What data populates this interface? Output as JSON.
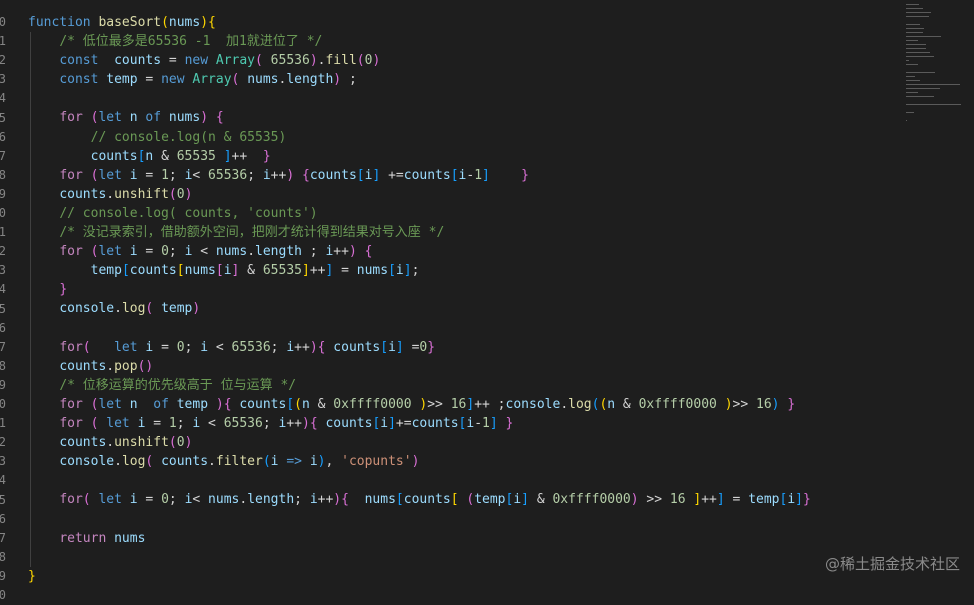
{
  "editor": {
    "gutter_numbers": [
      "0",
      "1",
      "2",
      "3",
      "4",
      "5",
      "6",
      "7",
      "8",
      "9",
      "0",
      "1",
      "2",
      "3",
      "4",
      "5",
      "6",
      "7",
      "8",
      "9",
      "0",
      "1",
      "2",
      "3",
      "4",
      "5",
      "6",
      "7",
      "8",
      "9",
      "0"
    ],
    "code_lines": [
      [
        [
          "kw",
          "function"
        ],
        [
          "op",
          " "
        ],
        [
          "fn",
          "baseSort"
        ],
        [
          "p1",
          "("
        ],
        [
          "var",
          "nums"
        ],
        [
          "p1",
          ")"
        ],
        [
          "p1",
          "{"
        ]
      ],
      [
        [
          "op",
          "    "
        ],
        [
          "cmt",
          "/* 低位最多是65536 -1  加1就进位了 */"
        ]
      ],
      [
        [
          "op",
          "    "
        ],
        [
          "kw",
          "const"
        ],
        [
          "op",
          "  "
        ],
        [
          "var",
          "counts"
        ],
        [
          "op",
          " = "
        ],
        [
          "kw",
          "new"
        ],
        [
          "op",
          " "
        ],
        [
          "cls",
          "Array"
        ],
        [
          "p2",
          "("
        ],
        [
          "op",
          " "
        ],
        [
          "num",
          "65536"
        ],
        [
          "p2",
          ")"
        ],
        [
          "op",
          "."
        ],
        [
          "fn",
          "fill"
        ],
        [
          "p2",
          "("
        ],
        [
          "num",
          "0"
        ],
        [
          "p2",
          ")"
        ]
      ],
      [
        [
          "op",
          "    "
        ],
        [
          "kw",
          "const"
        ],
        [
          "op",
          " "
        ],
        [
          "var",
          "temp"
        ],
        [
          "op",
          " = "
        ],
        [
          "kw",
          "new"
        ],
        [
          "op",
          " "
        ],
        [
          "cls",
          "Array"
        ],
        [
          "p2",
          "("
        ],
        [
          "op",
          " "
        ],
        [
          "var",
          "nums"
        ],
        [
          "op",
          "."
        ],
        [
          "var",
          "length"
        ],
        [
          "p2",
          ")"
        ],
        [
          "op",
          " ;"
        ]
      ],
      [
        [
          "op",
          ""
        ]
      ],
      [
        [
          "op",
          "    "
        ],
        [
          "ctl",
          "for"
        ],
        [
          "op",
          " "
        ],
        [
          "p2",
          "("
        ],
        [
          "kw",
          "let"
        ],
        [
          "op",
          " "
        ],
        [
          "var",
          "n"
        ],
        [
          "op",
          " "
        ],
        [
          "kw",
          "of"
        ],
        [
          "op",
          " "
        ],
        [
          "var",
          "nums"
        ],
        [
          "p2",
          ")"
        ],
        [
          "op",
          " "
        ],
        [
          "p2",
          "{"
        ]
      ],
      [
        [
          "op",
          "        "
        ],
        [
          "cmt",
          "// console.log(n & 65535)"
        ]
      ],
      [
        [
          "op",
          "        "
        ],
        [
          "var",
          "counts"
        ],
        [
          "p3",
          "["
        ],
        [
          "var",
          "n"
        ],
        [
          "op",
          " & "
        ],
        [
          "num",
          "65535"
        ],
        [
          "op",
          " "
        ],
        [
          "p3",
          "]"
        ],
        [
          "op",
          "++  "
        ],
        [
          "p2",
          "}"
        ]
      ],
      [
        [
          "op",
          "    "
        ],
        [
          "ctl",
          "for"
        ],
        [
          "op",
          " "
        ],
        [
          "p2",
          "("
        ],
        [
          "kw",
          "let"
        ],
        [
          "op",
          " "
        ],
        [
          "var",
          "i"
        ],
        [
          "op",
          " = "
        ],
        [
          "num",
          "1"
        ],
        [
          "op",
          "; "
        ],
        [
          "var",
          "i"
        ],
        [
          "op",
          "< "
        ],
        [
          "num",
          "65536"
        ],
        [
          "op",
          "; "
        ],
        [
          "var",
          "i"
        ],
        [
          "op",
          "++"
        ],
        [
          "p2",
          ")"
        ],
        [
          "op",
          " "
        ],
        [
          "p2",
          "{"
        ],
        [
          "var",
          "counts"
        ],
        [
          "p3",
          "["
        ],
        [
          "var",
          "i"
        ],
        [
          "p3",
          "]"
        ],
        [
          "op",
          " +="
        ],
        [
          "var",
          "counts"
        ],
        [
          "p3",
          "["
        ],
        [
          "var",
          "i"
        ],
        [
          "op",
          "-"
        ],
        [
          "num",
          "1"
        ],
        [
          "p3",
          "]"
        ],
        [
          "op",
          "    "
        ],
        [
          "p2",
          "}"
        ]
      ],
      [
        [
          "op",
          "    "
        ],
        [
          "var",
          "counts"
        ],
        [
          "op",
          "."
        ],
        [
          "fn",
          "unshift"
        ],
        [
          "p2",
          "("
        ],
        [
          "num",
          "0"
        ],
        [
          "p2",
          ")"
        ]
      ],
      [
        [
          "op",
          "    "
        ],
        [
          "cmt",
          "// console.log( counts, 'counts')"
        ]
      ],
      [
        [
          "op",
          "    "
        ],
        [
          "cmt",
          "/* 没记录索引，借助额外空间，把刚才统计得到结果对号入座 */"
        ]
      ],
      [
        [
          "op",
          "    "
        ],
        [
          "ctl",
          "for"
        ],
        [
          "op",
          " "
        ],
        [
          "p2",
          "("
        ],
        [
          "kw",
          "let"
        ],
        [
          "op",
          " "
        ],
        [
          "var",
          "i"
        ],
        [
          "op",
          " = "
        ],
        [
          "num",
          "0"
        ],
        [
          "op",
          "; "
        ],
        [
          "var",
          "i"
        ],
        [
          "op",
          " < "
        ],
        [
          "var",
          "nums"
        ],
        [
          "op",
          "."
        ],
        [
          "var",
          "length"
        ],
        [
          "op",
          " ; "
        ],
        [
          "var",
          "i"
        ],
        [
          "op",
          "++"
        ],
        [
          "p2",
          ")"
        ],
        [
          "op",
          " "
        ],
        [
          "p2",
          "{"
        ]
      ],
      [
        [
          "op",
          "        "
        ],
        [
          "var",
          "temp"
        ],
        [
          "p3",
          "["
        ],
        [
          "var",
          "counts"
        ],
        [
          "p1",
          "["
        ],
        [
          "var",
          "nums"
        ],
        [
          "p2",
          "["
        ],
        [
          "var",
          "i"
        ],
        [
          "p2",
          "]"
        ],
        [
          "op",
          " & "
        ],
        [
          "num",
          "65535"
        ],
        [
          "p1",
          "]"
        ],
        [
          "op",
          "++"
        ],
        [
          "p3",
          "]"
        ],
        [
          "op",
          " = "
        ],
        [
          "var",
          "nums"
        ],
        [
          "p3",
          "["
        ],
        [
          "var",
          "i"
        ],
        [
          "p3",
          "]"
        ],
        [
          "op",
          ";"
        ]
      ],
      [
        [
          "op",
          "    "
        ],
        [
          "p2",
          "}"
        ]
      ],
      [
        [
          "op",
          "    "
        ],
        [
          "var",
          "console"
        ],
        [
          "op",
          "."
        ],
        [
          "fn",
          "log"
        ],
        [
          "p2",
          "("
        ],
        [
          "op",
          " "
        ],
        [
          "var",
          "temp"
        ],
        [
          "p2",
          ")"
        ]
      ],
      [
        [
          "op",
          ""
        ]
      ],
      [
        [
          "op",
          "    "
        ],
        [
          "ctl",
          "for"
        ],
        [
          "p2",
          "("
        ],
        [
          "op",
          "   "
        ],
        [
          "kw",
          "let"
        ],
        [
          "op",
          " "
        ],
        [
          "var",
          "i"
        ],
        [
          "op",
          " = "
        ],
        [
          "num",
          "0"
        ],
        [
          "op",
          "; "
        ],
        [
          "var",
          "i"
        ],
        [
          "op",
          " < "
        ],
        [
          "num",
          "65536"
        ],
        [
          "op",
          "; "
        ],
        [
          "var",
          "i"
        ],
        [
          "op",
          "++"
        ],
        [
          "p2",
          ")"
        ],
        [
          "p2",
          "{"
        ],
        [
          "op",
          " "
        ],
        [
          "var",
          "counts"
        ],
        [
          "p3",
          "["
        ],
        [
          "var",
          "i"
        ],
        [
          "p3",
          "]"
        ],
        [
          "op",
          " ="
        ],
        [
          "num",
          "0"
        ],
        [
          "p2",
          "}"
        ]
      ],
      [
        [
          "op",
          "    "
        ],
        [
          "var",
          "counts"
        ],
        [
          "op",
          "."
        ],
        [
          "fn",
          "pop"
        ],
        [
          "p2",
          "("
        ],
        [
          "p2",
          ")"
        ]
      ],
      [
        [
          "op",
          "    "
        ],
        [
          "cmt",
          "/* 位移运算的优先级高于 位与运算 */"
        ]
      ],
      [
        [
          "op",
          "    "
        ],
        [
          "ctl",
          "for"
        ],
        [
          "op",
          " "
        ],
        [
          "p2",
          "("
        ],
        [
          "kw",
          "let"
        ],
        [
          "op",
          " "
        ],
        [
          "var",
          "n"
        ],
        [
          "op",
          "  "
        ],
        [
          "kw",
          "of"
        ],
        [
          "op",
          " "
        ],
        [
          "var",
          "temp"
        ],
        [
          "op",
          " "
        ],
        [
          "p2",
          ")"
        ],
        [
          "p2",
          "{"
        ],
        [
          "op",
          " "
        ],
        [
          "var",
          "counts"
        ],
        [
          "p3",
          "["
        ],
        [
          "p1",
          "("
        ],
        [
          "var",
          "n"
        ],
        [
          "op",
          " & "
        ],
        [
          "num",
          "0xffff0000"
        ],
        [
          "op",
          " "
        ],
        [
          "p1",
          ")"
        ],
        [
          "op",
          ">> "
        ],
        [
          "num",
          "16"
        ],
        [
          "p3",
          "]"
        ],
        [
          "op",
          "++ ;"
        ],
        [
          "var",
          "console"
        ],
        [
          "op",
          "."
        ],
        [
          "fn",
          "log"
        ],
        [
          "p3",
          "("
        ],
        [
          "p1",
          "("
        ],
        [
          "var",
          "n"
        ],
        [
          "op",
          " & "
        ],
        [
          "num",
          "0xffff0000"
        ],
        [
          "op",
          " "
        ],
        [
          "p1",
          ")"
        ],
        [
          "op",
          ">> "
        ],
        [
          "num",
          "16"
        ],
        [
          "p3",
          ")"
        ],
        [
          "op",
          " "
        ],
        [
          "p2",
          "}"
        ]
      ],
      [
        [
          "op",
          "    "
        ],
        [
          "ctl",
          "for"
        ],
        [
          "op",
          " "
        ],
        [
          "p2",
          "("
        ],
        [
          "op",
          " "
        ],
        [
          "kw",
          "let"
        ],
        [
          "op",
          " "
        ],
        [
          "var",
          "i"
        ],
        [
          "op",
          " = "
        ],
        [
          "num",
          "1"
        ],
        [
          "op",
          "; "
        ],
        [
          "var",
          "i"
        ],
        [
          "op",
          " < "
        ],
        [
          "num",
          "65536"
        ],
        [
          "op",
          "; "
        ],
        [
          "var",
          "i"
        ],
        [
          "op",
          "++"
        ],
        [
          "p2",
          ")"
        ],
        [
          "p2",
          "{"
        ],
        [
          "op",
          " "
        ],
        [
          "var",
          "counts"
        ],
        [
          "p3",
          "["
        ],
        [
          "var",
          "i"
        ],
        [
          "p3",
          "]"
        ],
        [
          "op",
          "+="
        ],
        [
          "var",
          "counts"
        ],
        [
          "p3",
          "["
        ],
        [
          "var",
          "i"
        ],
        [
          "op",
          "-"
        ],
        [
          "num",
          "1"
        ],
        [
          "p3",
          "]"
        ],
        [
          "op",
          " "
        ],
        [
          "p2",
          "}"
        ]
      ],
      [
        [
          "op",
          "    "
        ],
        [
          "var",
          "counts"
        ],
        [
          "op",
          "."
        ],
        [
          "fn",
          "unshift"
        ],
        [
          "p2",
          "("
        ],
        [
          "num",
          "0"
        ],
        [
          "p2",
          ")"
        ]
      ],
      [
        [
          "op",
          "    "
        ],
        [
          "var",
          "console"
        ],
        [
          "op",
          "."
        ],
        [
          "fn",
          "log"
        ],
        [
          "p2",
          "("
        ],
        [
          "op",
          " "
        ],
        [
          "var",
          "counts"
        ],
        [
          "op",
          "."
        ],
        [
          "fn",
          "filter"
        ],
        [
          "p3",
          "("
        ],
        [
          "var",
          "i"
        ],
        [
          "op",
          " "
        ],
        [
          "kw",
          "=>"
        ],
        [
          "op",
          " "
        ],
        [
          "var",
          "i"
        ],
        [
          "p3",
          ")"
        ],
        [
          "op",
          ", "
        ],
        [
          "str",
          "'copunts'"
        ],
        [
          "p2",
          ")"
        ]
      ],
      [
        [
          "op",
          ""
        ]
      ],
      [
        [
          "op",
          "    "
        ],
        [
          "ctl",
          "for"
        ],
        [
          "p2",
          "("
        ],
        [
          "op",
          " "
        ],
        [
          "kw",
          "let"
        ],
        [
          "op",
          " "
        ],
        [
          "var",
          "i"
        ],
        [
          "op",
          " = "
        ],
        [
          "num",
          "0"
        ],
        [
          "op",
          "; "
        ],
        [
          "var",
          "i"
        ],
        [
          "op",
          "< "
        ],
        [
          "var",
          "nums"
        ],
        [
          "op",
          "."
        ],
        [
          "var",
          "length"
        ],
        [
          "op",
          "; "
        ],
        [
          "var",
          "i"
        ],
        [
          "op",
          "++"
        ],
        [
          "p2",
          ")"
        ],
        [
          "p2",
          "{"
        ],
        [
          "op",
          "  "
        ],
        [
          "var",
          "nums"
        ],
        [
          "p3",
          "["
        ],
        [
          "var",
          "counts"
        ],
        [
          "p1",
          "["
        ],
        [
          "op",
          " "
        ],
        [
          "p2",
          "("
        ],
        [
          "var",
          "temp"
        ],
        [
          "p3",
          "["
        ],
        [
          "var",
          "i"
        ],
        [
          "p3",
          "]"
        ],
        [
          "op",
          " & "
        ],
        [
          "num",
          "0xffff0000"
        ],
        [
          "p2",
          ")"
        ],
        [
          "op",
          " >> "
        ],
        [
          "num",
          "16"
        ],
        [
          "op",
          " "
        ],
        [
          "p1",
          "]"
        ],
        [
          "op",
          "++"
        ],
        [
          "p3",
          "]"
        ],
        [
          "op",
          " = "
        ],
        [
          "var",
          "temp"
        ],
        [
          "p3",
          "["
        ],
        [
          "var",
          "i"
        ],
        [
          "p3",
          "]"
        ],
        [
          "p2",
          "}"
        ]
      ],
      [
        [
          "op",
          ""
        ]
      ],
      [
        [
          "op",
          "    "
        ],
        [
          "ctl",
          "return"
        ],
        [
          "op",
          " "
        ],
        [
          "var",
          "nums"
        ]
      ],
      [
        [
          "op",
          ""
        ]
      ],
      [
        [
          "p1",
          "}"
        ]
      ]
    ]
  },
  "watermark": "@稀土掘金技术社区"
}
